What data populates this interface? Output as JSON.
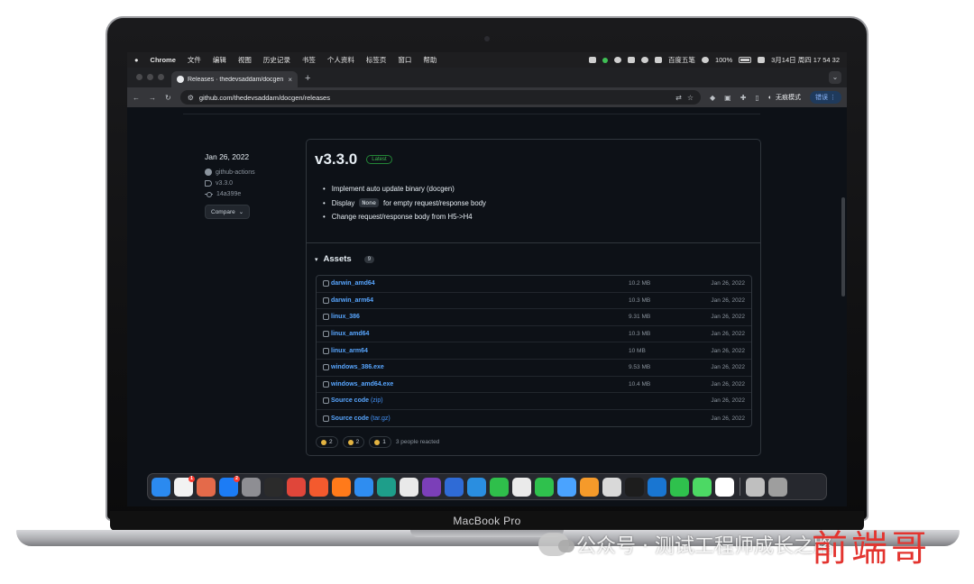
{
  "device": {
    "label": "MacBook Pro"
  },
  "watermark": {
    "text": "公众号 · 测试工程师成长之路",
    "overlay": "前端哥"
  },
  "menubar": {
    "app": "Chrome",
    "items": [
      "文件",
      "编辑",
      "视图",
      "历史记录",
      "书签",
      "个人资料",
      "标签页",
      "窗口",
      "帮助"
    ],
    "ime": "百度五笔",
    "battery": "100%",
    "datetime": "3月14日 周四  17 54 32"
  },
  "browser": {
    "tab_title": "Releases · thedevsaddam/docgen",
    "url": "github.com/thedevsaddam/docgen/releases",
    "incognito": "无痕模式",
    "error_button": "错误"
  },
  "release": {
    "date": "Jan 26, 2022",
    "author": "github-actions",
    "tag": "v3.3.0",
    "commit": "14a399e",
    "compare_label": "Compare",
    "title": "v3.3.0",
    "badge": "Latest",
    "notes": {
      "n1": "Implement auto update binary (docgen)",
      "n2_pre": "Display",
      "n2_code": "None",
      "n2_post": "for empty request/response body",
      "n3": "Change request/response body from H5->H4"
    },
    "assets_title": "Assets",
    "assets_count": "9",
    "assets": [
      {
        "name": "darwin_amd64",
        "suffix": "",
        "size": "10.2 MB",
        "date": "Jan 26, 2022"
      },
      {
        "name": "darwin_arm64",
        "suffix": "",
        "size": "10.3 MB",
        "date": "Jan 26, 2022"
      },
      {
        "name": "linux_386",
        "suffix": "",
        "size": "9.31 MB",
        "date": "Jan 26, 2022"
      },
      {
        "name": "linux_amd64",
        "suffix": "",
        "size": "10.3 MB",
        "date": "Jan 26, 2022"
      },
      {
        "name": "linux_arm64",
        "suffix": "",
        "size": "10 MB",
        "date": "Jan 26, 2022"
      },
      {
        "name": "windows_386.exe",
        "suffix": "",
        "size": "9.53 MB",
        "date": "Jan 26, 2022"
      },
      {
        "name": "windows_amd64.exe",
        "suffix": "",
        "size": "10.4 MB",
        "date": "Jan 26, 2022"
      },
      {
        "name": "Source code",
        "suffix": "(zip)",
        "size": "",
        "date": "Jan 26, 2022"
      },
      {
        "name": "Source code",
        "suffix": "(tar.gz)",
        "size": "",
        "date": "Jan 26, 2022"
      }
    ],
    "reactions": {
      "thumbs": "2",
      "smile": "2",
      "tada": "1",
      "summary": "3 people reacted"
    }
  },
  "dock": {
    "badges": {
      "reminders": "1",
      "appstore": "2"
    },
    "apps": [
      {
        "name": "finder",
        "color": "#2b8af0"
      },
      {
        "name": "reminders",
        "color": "#f2f2f2"
      },
      {
        "name": "launchpad",
        "color": "#e46a4a"
      },
      {
        "name": "appstore",
        "color": "#1c7cf5"
      },
      {
        "name": "settings",
        "color": "#8e8e93"
      },
      {
        "name": "terminal",
        "color": "#2b2b2b"
      },
      {
        "name": "git-client",
        "color": "#e0463a"
      },
      {
        "name": "brush-app",
        "color": "#f45a2e"
      },
      {
        "name": "firefox",
        "color": "#ff7a1a"
      },
      {
        "name": "safari",
        "color": "#2f8df0"
      },
      {
        "name": "edge",
        "color": "#1e9e8a"
      },
      {
        "name": "chrome",
        "color": "#e9e9e9"
      },
      {
        "name": "onenote",
        "color": "#7b3fb8"
      },
      {
        "name": "intellij",
        "color": "#2f6bd6"
      },
      {
        "name": "vscode",
        "color": "#2a8ee0"
      },
      {
        "name": "pycharm",
        "color": "#2fbf4b"
      },
      {
        "name": "chat-app",
        "color": "#eaeaea"
      },
      {
        "name": "wechat",
        "color": "#2fc14d"
      },
      {
        "name": "qq-browser",
        "color": "#4aa3ff"
      },
      {
        "name": "crown-app",
        "color": "#f59a2a"
      },
      {
        "name": "jug-app",
        "color": "#d9d9d9"
      },
      {
        "name": "qq",
        "color": "#1d1d1d"
      },
      {
        "name": "typora",
        "color": "#1976d2"
      },
      {
        "name": "wechat-work",
        "color": "#2fc14d"
      },
      {
        "name": "android-app",
        "color": "#4cd964"
      },
      {
        "name": "text-app",
        "color": "#ffffff"
      },
      {
        "name": "folder",
        "color": "#bfbfbf"
      },
      {
        "name": "trash",
        "color": "#9e9e9e"
      }
    ]
  }
}
